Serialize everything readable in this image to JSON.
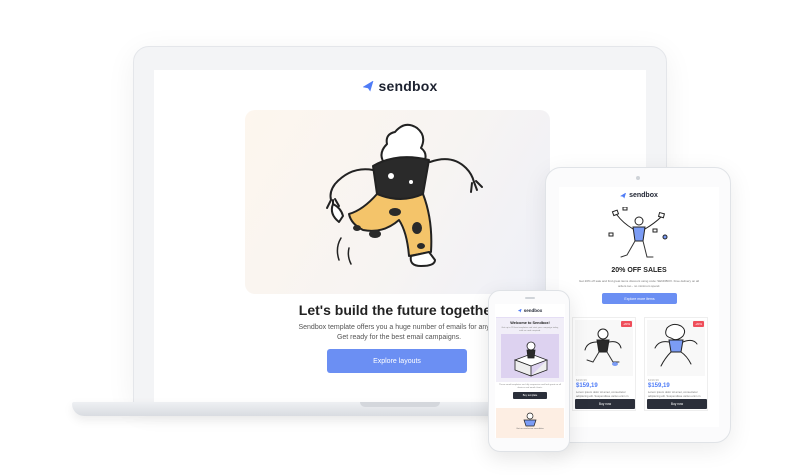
{
  "brand": {
    "name": "sendbox",
    "accent": "#4f7cf7",
    "button_color": "#6b8ff3",
    "dark": "#2b2f3a",
    "sale_red": "#ef4e5a"
  },
  "laptop": {
    "title": "Let's build the future together!",
    "body_line1": "Sendbox template offers you a huge number of emails for any ne",
    "body_line2": "Get ready for the best email campaigns.",
    "button_label": "Explore layouts"
  },
  "tablet": {
    "headline": "20% OFF SALES",
    "body": "Get 20% off sale and find great items discount using code: SENDBOX. Free delivery on all orders too - no minimum spend.",
    "button_label": "Explore more items",
    "products": [
      {
        "badge": "-20%",
        "old_price": "$199,99",
        "price": "$159,19",
        "desc": "Lorem ipsum dolor sit amet, consectetur adipiscing elit. Suspendisse varius enim in",
        "button": "Buy now"
      },
      {
        "badge": "-20%",
        "old_price": "$199,99",
        "price": "$159,19",
        "desc": "Lorem ipsum dolor sit amet, consectetur adipiscing elit. Suspendisse varius enim in",
        "button": "Buy now"
      }
    ]
  },
  "phone": {
    "welcome_title": "Welcome to Sendbox!",
    "welcome_text": "Get up to 20 free templates and start your campaign today, with no code required.",
    "body_text": "These email templates are fully responsive and look great on all devices and email clients.",
    "button_label": "Buy template",
    "card_text": "Get our exclusive newsletter"
  }
}
